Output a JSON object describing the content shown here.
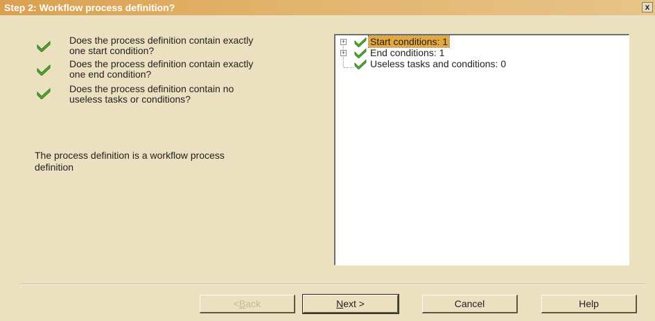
{
  "window": {
    "title": "Step 2: Workflow process definition?",
    "close_label": "x"
  },
  "questions": [
    {
      "text_line1": "Does the process definition contain exactly",
      "text_line2": "one start condition?"
    },
    {
      "text_line1": "Does the process definition contain exactly",
      "text_line2": "one end condition?"
    },
    {
      "text_line1": "Does the process definition contain no",
      "text_line2": "useless tasks or conditions?"
    }
  ],
  "result": {
    "line1": "The process definition is a workflow process",
    "line2": "definition"
  },
  "tree": {
    "items": [
      {
        "label": "Start conditions: 1",
        "expandable": true,
        "selected": true
      },
      {
        "label": "End conditions: 1",
        "expandable": true,
        "selected": false
      },
      {
        "label": "Useless tasks and conditions: 0",
        "expandable": false,
        "selected": false
      }
    ]
  },
  "buttons": {
    "back": {
      "pre": "< ",
      "u": "B",
      "post": "ack"
    },
    "next": {
      "u": "N",
      "post": "ext >"
    },
    "cancel": "Cancel",
    "help": "Help"
  },
  "colors": {
    "check": "#5aa832",
    "check_dark": "#2e7a18",
    "selection": "#e4a83e"
  }
}
